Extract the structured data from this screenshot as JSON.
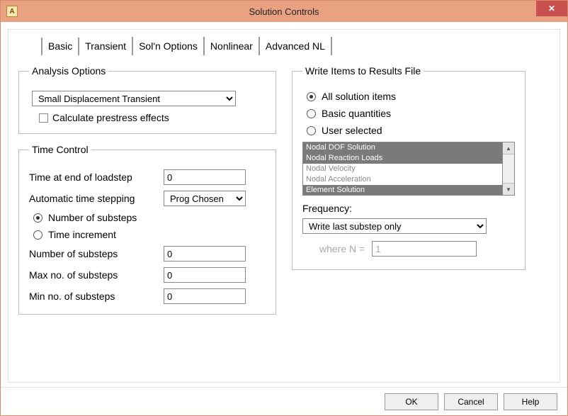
{
  "window": {
    "title": "Solution Controls",
    "app_icon_letter": "A"
  },
  "tabs": [
    {
      "label": "Basic",
      "active": true
    },
    {
      "label": "Transient",
      "active": false
    },
    {
      "label": "Sol'n Options",
      "active": false
    },
    {
      "label": "Nonlinear",
      "active": false
    },
    {
      "label": "Advanced NL",
      "active": false
    }
  ],
  "analysis": {
    "legend": "Analysis Options",
    "selected": "Small Displacement Transient",
    "prestress_label": "Calculate prestress effects",
    "prestress_checked": false
  },
  "time_control": {
    "legend": "Time Control",
    "time_end_label": "Time at end of loadstep",
    "time_end_value": "0",
    "ats_label": "Automatic time stepping",
    "ats_value": "Prog Chosen",
    "radio_substeps_label": "Number of substeps",
    "radio_increment_label": "Time increment",
    "radio_selected": "substeps",
    "num_substeps_label": "Number of substeps",
    "num_substeps_value": "0",
    "max_substeps_label": "Max no. of substeps",
    "max_substeps_value": "0",
    "min_substeps_label": "Min no. of substeps",
    "min_substeps_value": "0"
  },
  "write_items": {
    "legend": "Write Items to Results File",
    "radios": {
      "all_label": "All solution items",
      "basic_label": "Basic quantities",
      "user_label": "User selected",
      "selected": "all"
    },
    "list": [
      {
        "label": "Nodal DOF Solution",
        "selected": true,
        "enabled": true
      },
      {
        "label": "Nodal Reaction Loads",
        "selected": true,
        "enabled": true
      },
      {
        "label": "Nodal Velocity",
        "selected": false,
        "enabled": false
      },
      {
        "label": "Nodal Acceleration",
        "selected": false,
        "enabled": false
      },
      {
        "label": "Element Solution",
        "selected": true,
        "enabled": true
      }
    ],
    "frequency_label": "Frequency:",
    "frequency_value": "Write last substep only",
    "where_n_label": "where N =",
    "where_n_value": "1"
  },
  "footer": {
    "ok": "OK",
    "cancel": "Cancel",
    "help": "Help"
  }
}
